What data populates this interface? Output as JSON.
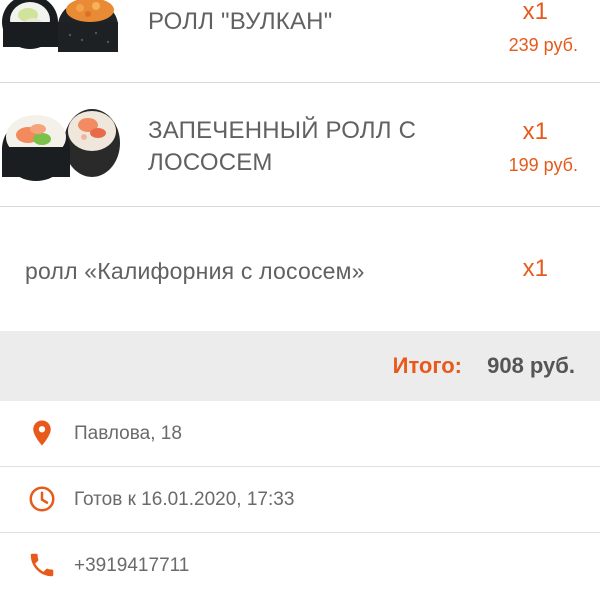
{
  "order": {
    "items": [
      {
        "name": "РОЛЛ \"ВУЛКАН\"",
        "qty": "x1",
        "price": "239 руб."
      },
      {
        "name": "ЗАПЕЧЕННЫЙ РОЛЛ С ЛОСОСЕМ",
        "qty": "x1",
        "price": "199 руб."
      },
      {
        "name": "ролл «Калифорния с лососем»",
        "qty": "x1"
      }
    ],
    "total_label": "Итого:",
    "total_value": "908 руб."
  },
  "info": {
    "address": "Павлова, 18",
    "ready": "Готов к 16.01.2020, 17:33",
    "phone": "+3919417711"
  },
  "colors": {
    "accent": "#e85a1b",
    "text": "#616161",
    "total_bar": "#ececec"
  },
  "icons": {
    "address": "location-pin-icon",
    "ready": "clock-icon",
    "phone": "phone-icon"
  }
}
